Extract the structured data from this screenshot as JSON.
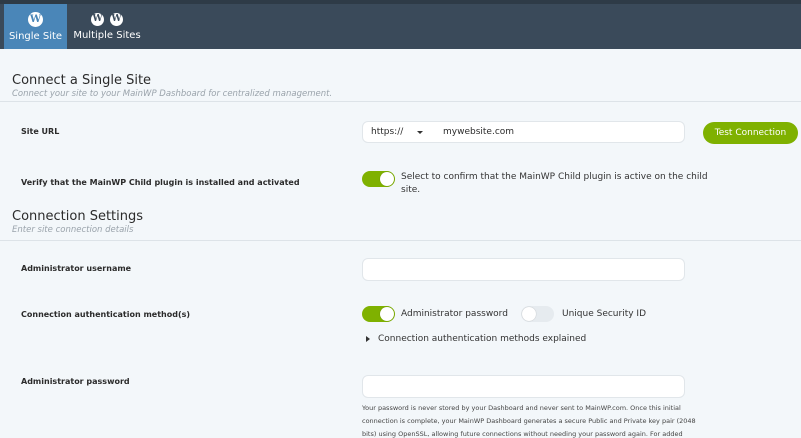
{
  "tabs": [
    {
      "label": "Single Site",
      "active": true
    },
    {
      "label": "Multiple Sites",
      "active": false
    }
  ],
  "connect": {
    "title": "Connect a Single Site",
    "subtitle": "Connect your site to your MainWP Dashboard for centralized management."
  },
  "site_url": {
    "label": "Site URL",
    "protocol": "https://",
    "value": "mywebsite.com",
    "button": "Test Connection"
  },
  "verify": {
    "label": "Verify that the MainWP Child plugin is installed and activated",
    "toggle_on": true,
    "text_line1": "Select to confirm that the MainWP Child plugin is active on the child",
    "text_line2": "site."
  },
  "settings": {
    "title": "Connection Settings",
    "subtitle": "Enter site connection details"
  },
  "admin_username": {
    "label": "Administrator username",
    "value": ""
  },
  "auth": {
    "label": "Connection authentication method(s)",
    "option1": {
      "label": "Administrator password",
      "on": true
    },
    "option2": {
      "label": "Unique Security ID",
      "on": false
    },
    "explained": "Connection authentication methods explained"
  },
  "admin_password": {
    "label": "Administrator password",
    "value": "",
    "help_line1": "Your password is never stored by your Dashboard and never sent to MainWP.com. Once this initial",
    "help_line2": "connection is complete, your MainWP Dashboard generates a secure Public and Private key pair (2048",
    "help_line3": "bits) using OpenSSL, allowing future connections without needing your password again. For added"
  },
  "colors": {
    "accent_green": "#7fb100",
    "active_tab": "#4a86b8",
    "topbar": "#3a4a5a"
  }
}
